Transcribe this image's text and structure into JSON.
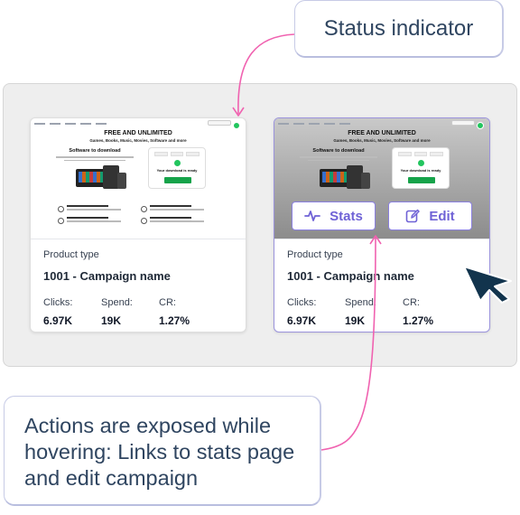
{
  "annotations": {
    "status_callout": "Status indicator",
    "actions_callout": "Actions are exposed while hovering: Links to stats page and edit campaign"
  },
  "thumbnail": {
    "headline_pre": "FREE AND ",
    "headline_bold": "UNLIMITED",
    "subheadline": "Games, Books, Music, Movies, Software and more",
    "section_title": "Software to download",
    "ready_text": "Your download is ready",
    "status_color": "#22c55e"
  },
  "cards": [
    {
      "product_type_label": "Product type",
      "campaign_name": "1001 - Campaign name",
      "clicks_label": "Clicks:",
      "clicks_value": "6.97K",
      "spend_label": "Spend:",
      "spend_value": "19K",
      "cr_label": "CR:",
      "cr_value": "1.27%"
    },
    {
      "product_type_label": "Product type",
      "campaign_name": "1001 - Campaign name",
      "clicks_label": "Clicks:",
      "clicks_value": "6.97K",
      "spend_label": "Spend:",
      "spend_value": "19K",
      "cr_label": "CR:",
      "cr_value": "1.27%"
    }
  ],
  "hover_actions": {
    "stats_label": "Stats",
    "stats_icon": "activity-icon",
    "edit_label": "Edit",
    "edit_icon": "edit-icon",
    "accent_color": "#6f62d6"
  },
  "colors": {
    "annotation_arrow": "#f062b0",
    "cursor": "#12344d"
  }
}
